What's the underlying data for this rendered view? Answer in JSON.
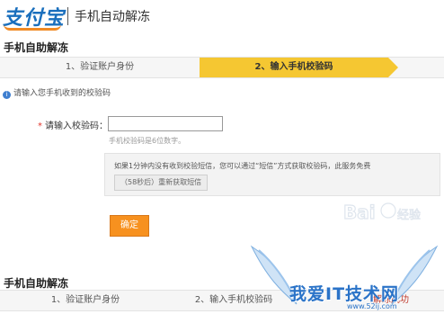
{
  "header": {
    "logo_text": "支付宝",
    "title": "手机自动解冻"
  },
  "section1": {
    "title": "手机自助解冻",
    "steps": [
      "1、验证账户身份",
      "2、输入手机校验码"
    ]
  },
  "hint": "请输入您手机收到的校验码",
  "form": {
    "required_mark": "*",
    "label": "请输入校验码：",
    "value": "",
    "tip": "手机校验码是6位数字。",
    "note": "如果1分钟内没有收到校验短信，您可以通过“短信”方式获取校验码，此服务免费",
    "resend_label": "（58秒后）重新获取短信",
    "confirm_label": "确定"
  },
  "section2": {
    "title": "手机自助解冻",
    "steps": [
      "1、验证账户身份",
      "2、输入手机校验码",
      "解冻成功"
    ]
  },
  "watermark": {
    "baidu": "Baidu经验",
    "site_title": "我爱IT技术网",
    "site_url": "www.52ij.com"
  },
  "colors": {
    "active_step": "#f5c732",
    "button": "#f7911f",
    "brand": "#1a6fbd",
    "watermark": "#2a73c8"
  }
}
